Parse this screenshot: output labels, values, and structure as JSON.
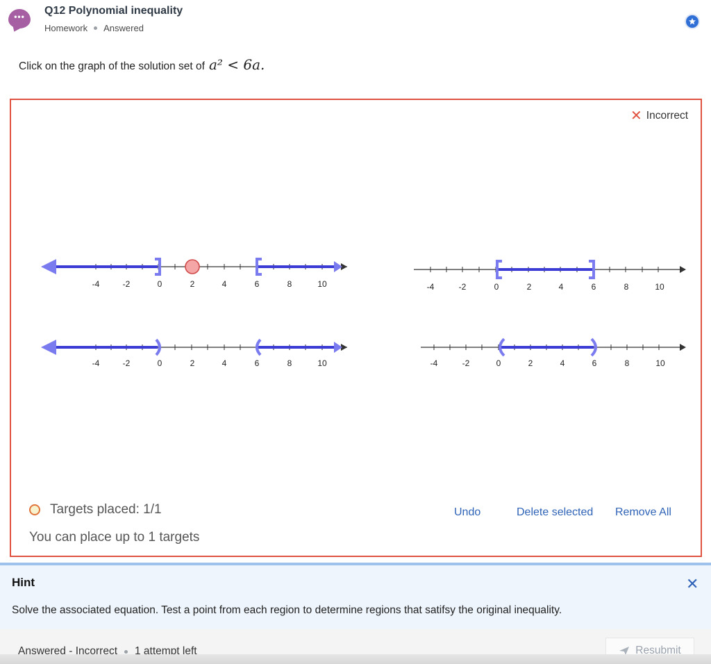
{
  "header": {
    "title": "Q12 Polynomial inequality",
    "type": "Homework",
    "status": "Answered"
  },
  "question": {
    "prompt": "Click on the graph of the solution set of",
    "math": "a² < 6a."
  },
  "result": {
    "label": "Incorrect"
  },
  "graphs": {
    "tick_labels": [
      "-4",
      "-2",
      "0",
      "2",
      "4",
      "6",
      "8",
      "10"
    ],
    "options": [
      {
        "id": "A",
        "description": "a ≤ 0 or a ≥ 6"
      },
      {
        "id": "B",
        "description": "0 ≤ a ≤ 6"
      },
      {
        "id": "C",
        "description": "a < 0 or a > 6"
      },
      {
        "id": "D",
        "description": "0 < a < 6"
      }
    ]
  },
  "targets": {
    "placed_text": "Targets placed: 1/1",
    "limit_text": "You can place up to 1 targets"
  },
  "actions": {
    "undo": "Undo",
    "delete_selected": "Delete selected",
    "remove_all": "Remove All"
  },
  "hint": {
    "title": "Hint",
    "text": "Solve the associated equation. Test a point from each region to determine regions that satifsy the original inequality."
  },
  "footer": {
    "status": "Answered - Incorrect",
    "attempts": "1 attempt left",
    "resubmit": "Resubmit"
  },
  "colors": {
    "accent": "#2f63b8",
    "error": "#e0523f",
    "graph_fill": "#7b7bf0",
    "graph_line": "#3b3bd6"
  }
}
